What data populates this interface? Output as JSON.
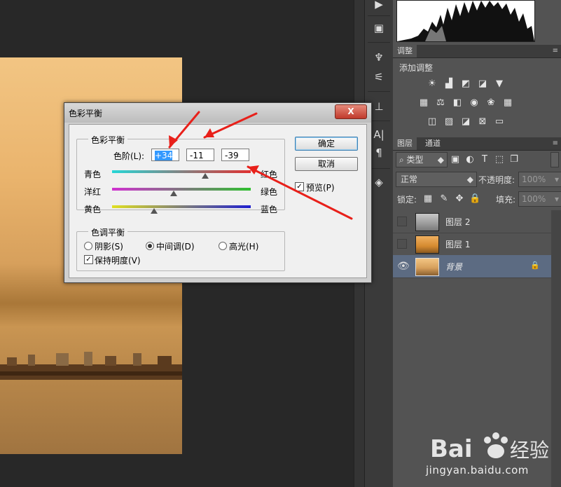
{
  "dialog": {
    "title": "色彩平衡",
    "close_label": "X",
    "color_balance_group": "色彩平衡",
    "levels_label": "色阶(L):",
    "levels": [
      "+34",
      "-11",
      "-39"
    ],
    "sliders": [
      {
        "left": "青色",
        "right": "红色",
        "value": 34
      },
      {
        "left": "洋红",
        "right": "绿色",
        "value": -11
      },
      {
        "left": "黄色",
        "right": "蓝色",
        "value": -39
      }
    ],
    "tone_group": "色调平衡",
    "tones": [
      {
        "label": "阴影(S)",
        "checked": false
      },
      {
        "label": "中间调(D)",
        "checked": true
      },
      {
        "label": "高光(H)",
        "checked": false
      }
    ],
    "preserve_luminosity": "保持明度(V)",
    "preserve_checked": true,
    "ok_label": "确定",
    "cancel_label": "取消",
    "preview_label": "预览(P)",
    "preview_checked": true
  },
  "adjustments": {
    "tab": "调整",
    "title": "添加调整"
  },
  "layers": {
    "tabs": [
      "图层",
      "通道"
    ],
    "kind_filter": "类型",
    "blend_mode": "正常",
    "opacity_label": "不透明度:",
    "opacity_value": "100%",
    "lock_label": "锁定:",
    "fill_label": "填充:",
    "fill_value": "100%",
    "items": [
      {
        "name": "图层 2",
        "selected": false,
        "visible": false
      },
      {
        "name": "图层 1",
        "selected": false,
        "visible": false
      },
      {
        "name": "背景",
        "selected": true,
        "visible": true,
        "locked": true
      }
    ]
  },
  "watermark": {
    "brand": "Bai 经验",
    "url": "jingyan.baidu.com"
  },
  "colors": {
    "arrow": "#e8201a",
    "selected_layer": "#5c6b82"
  }
}
